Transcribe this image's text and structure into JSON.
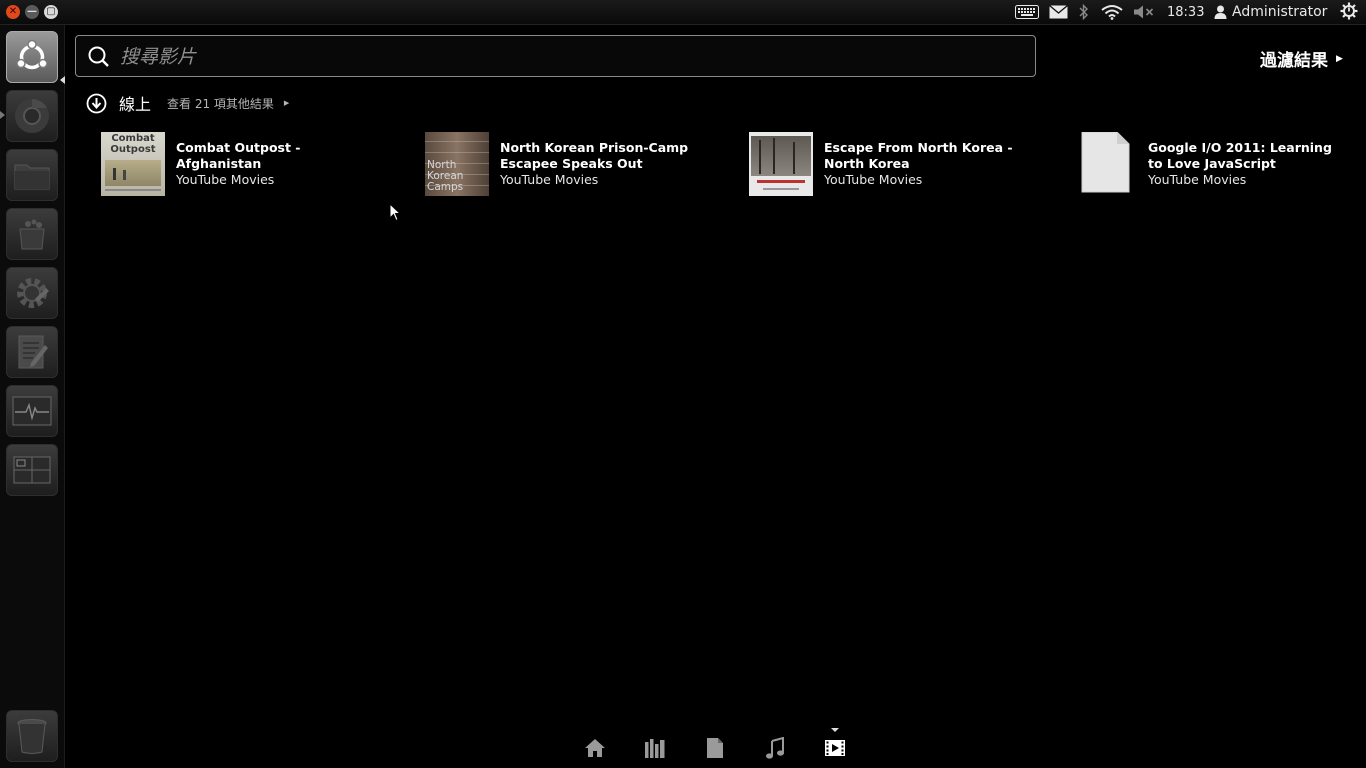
{
  "top_panel": {
    "window_buttons": {
      "close_icon": "close-icon",
      "minimize_icon": "minimize-icon",
      "maximize_icon": "maximize-icon"
    },
    "tray_icons": [
      "keyboard-icon",
      "mail-icon",
      "bluetooth-icon",
      "wifi-icon",
      "volume-muted-icon"
    ],
    "clock": "18:33",
    "user": "Administrator",
    "session_icon": "power-gear-icon"
  },
  "launcher": {
    "items": [
      "dash-home",
      "chromium-browser",
      "files",
      "ubuntu-software-center",
      "system-settings",
      "text-editor",
      "system-monitor",
      "workspace-switcher",
      "trash"
    ]
  },
  "search": {
    "placeholder": "搜尋影片",
    "value": ""
  },
  "filter": {
    "label": "過濾結果"
  },
  "category": {
    "title": "線上",
    "see_more": "查看 21 項其他結果"
  },
  "results": [
    {
      "title": "Combat Outpost - Afghanistan",
      "subtitle": "YouTube Movies",
      "thumb_text": "Combat Outpost"
    },
    {
      "title": "North Korean Prison-Camp Escapee Speaks Out",
      "subtitle": "YouTube Movies",
      "thumb_text": "North Korean Camps"
    },
    {
      "title": "Escape From North Korea - North Korea",
      "subtitle": "YouTube Movies",
      "thumb_text": ""
    },
    {
      "title": "Google I/O 2011: Learning to Love JavaScript",
      "subtitle": "YouTube Movies",
      "thumb_text": ""
    }
  ],
  "lenses": [
    "home-icon",
    "applications-icon",
    "files-icon",
    "music-icon",
    "video-icon"
  ],
  "active_lens": "video-icon",
  "colors": {
    "accent": "#e0491b",
    "background": "#000000"
  }
}
